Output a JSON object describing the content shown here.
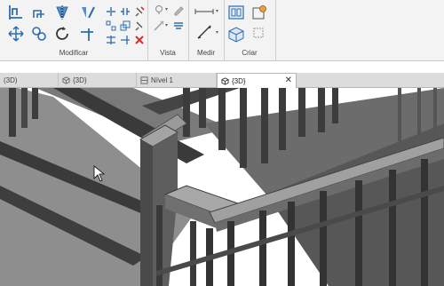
{
  "ribbon": {
    "panels": {
      "modify": "Modificar",
      "view": "Vista",
      "measure": "Medir",
      "create": "Criar"
    }
  },
  "tabs": [
    {
      "label": "(3D)",
      "icon": "none",
      "active": false
    },
    {
      "label": "{3D}",
      "icon": "3d-view-icon",
      "active": false
    },
    {
      "label": "Nível 1",
      "icon": "floor-plan-icon",
      "active": false
    },
    {
      "label": "{3D}",
      "icon": "3d-view-icon",
      "active": true
    }
  ],
  "close_glyph": "✕",
  "colors": {
    "ribbon_bg": "#f3f3f3",
    "tab_strip_bg": "#dcdcdc",
    "model_dark": "#3c3c3c",
    "model_mid": "#6a6a6a",
    "model_light": "#9a9a9a",
    "accent_blue": "#2b6cb0",
    "delete_red": "#d32f2f"
  }
}
